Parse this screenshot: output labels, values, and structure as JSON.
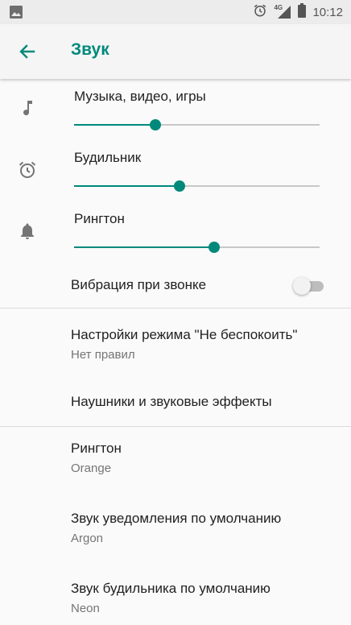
{
  "status_bar": {
    "time": "10:12",
    "network_label": "4G",
    "icons": [
      "image-icon",
      "alarm-icon",
      "signal-icon",
      "battery-icon"
    ]
  },
  "app_bar": {
    "title": "Звук",
    "back_icon": "arrow-back-icon"
  },
  "colors": {
    "accent": "#00897b",
    "status_bar_bg": "#ececec",
    "app_bar_bg": "#f5f5f5",
    "background": "#fafafa"
  },
  "volumes": [
    {
      "label": "Музыка, видео, игры",
      "icon": "music-note-icon",
      "level": 0.33
    },
    {
      "label": "Будильник",
      "icon": "alarm-icon",
      "level": 0.43
    },
    {
      "label": "Рингтон",
      "icon": "bell-icon",
      "level": 0.57
    }
  ],
  "vibration": {
    "label": "Вибрация при звонке",
    "enabled": false
  },
  "preferences": [
    {
      "title": "Настройки режима \"Не беспокоить\"",
      "summary": "Нет правил"
    },
    {
      "title": "Наушники и звуковые эффекты",
      "summary": ""
    },
    {
      "title": "Рингтон",
      "summary": "Orange"
    },
    {
      "title": "Звук уведомления по умолчанию",
      "summary": "Argon"
    },
    {
      "title": "Звук будильника по умолчанию",
      "summary": "Neon"
    }
  ]
}
